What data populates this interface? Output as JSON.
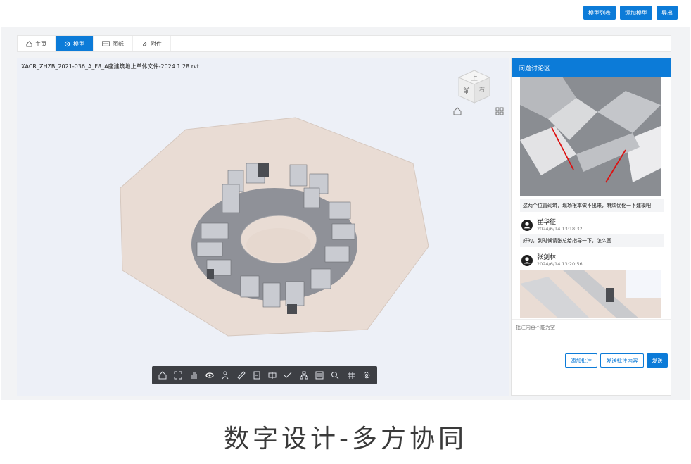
{
  "header": {
    "model_list_label": "模型列表",
    "add_model_label": "添加模型",
    "export_label": "导出"
  },
  "tabs": [
    {
      "label": "主页",
      "icon": "home-icon"
    },
    {
      "label": "模型",
      "icon": "model-icon"
    },
    {
      "label": "图纸",
      "icon": "drawing-icon"
    },
    {
      "label": "附件",
      "icon": "paperclip-icon"
    }
  ],
  "viewer": {
    "filename": "XACR_ZHZB_2021-036_A_F8_A座建筑地上单体文件-2024.1.28.rvt",
    "cube_faces": {
      "top": "上",
      "front": "前",
      "right": "右"
    },
    "toolbar_icons": [
      "home-icon",
      "fit-view-icon",
      "pan-hand-icon",
      "orbit-icon",
      "person-icon",
      "measure-icon",
      "section-icon",
      "middle-icon",
      "check-icon",
      "structure-tree-icon",
      "properties-icon",
      "search-icon",
      "grid-icon",
      "settings-icon"
    ]
  },
  "discussion": {
    "title": "问题讨论区",
    "comments": [
      {
        "text": "这两个位置砌筑，现场根本做不出来，麻烦优化一下建模吧"
      },
      {
        "user": "崔华征",
        "time": "2024/6/14 13:18:32",
        "text": "好的，到时候请张总给指导一下，怎么画"
      },
      {
        "user": "张剑林",
        "time": "2024/6/14 13:20:56"
      }
    ],
    "input_placeholder": "批注内容不能为空",
    "add_annotation_label": "添加批注",
    "send_annotation_label": "发送批注内容",
    "send_label": "发送"
  },
  "caption": "数字设计-多方协同",
  "colors": {
    "accent": "#0c7bd8",
    "toolbar": "#3d3f44",
    "floor": "#e9dcd4"
  }
}
